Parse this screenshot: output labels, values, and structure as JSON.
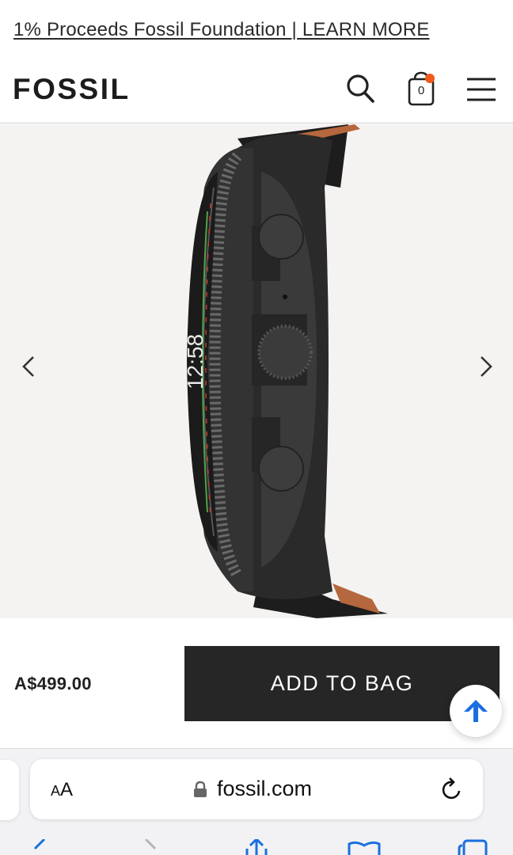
{
  "promo": {
    "text": "1% Proceeds Fossil Foundation | LEARN MORE"
  },
  "header": {
    "logo": "FOSSIL",
    "search_icon": "search-icon",
    "bag_icon": "shopping-bag-icon",
    "bag_count": "0",
    "menu_icon": "hamburger-menu-icon",
    "badge_color": "#f05a1a"
  },
  "gallery": {
    "image": "smartwatch-side-view",
    "prev_icon": "chevron-left-icon",
    "next_icon": "chevron-right-icon"
  },
  "product": {
    "price": "A$499.00",
    "add_to_bag_label": "ADD TO BAG",
    "button_color": "#262626",
    "scroll_top_icon": "arrow-up-icon",
    "scroll_top_color": "#1a6fe0"
  },
  "browser": {
    "text_size_label_small": "A",
    "text_size_label_large": "A",
    "domain": "fossil.com",
    "lock_icon": "lock-icon",
    "reload_icon": "reload-icon",
    "toolbar": [
      "back-icon",
      "forward-icon",
      "share-icon",
      "bookmarks-icon",
      "tabs-icon"
    ]
  }
}
